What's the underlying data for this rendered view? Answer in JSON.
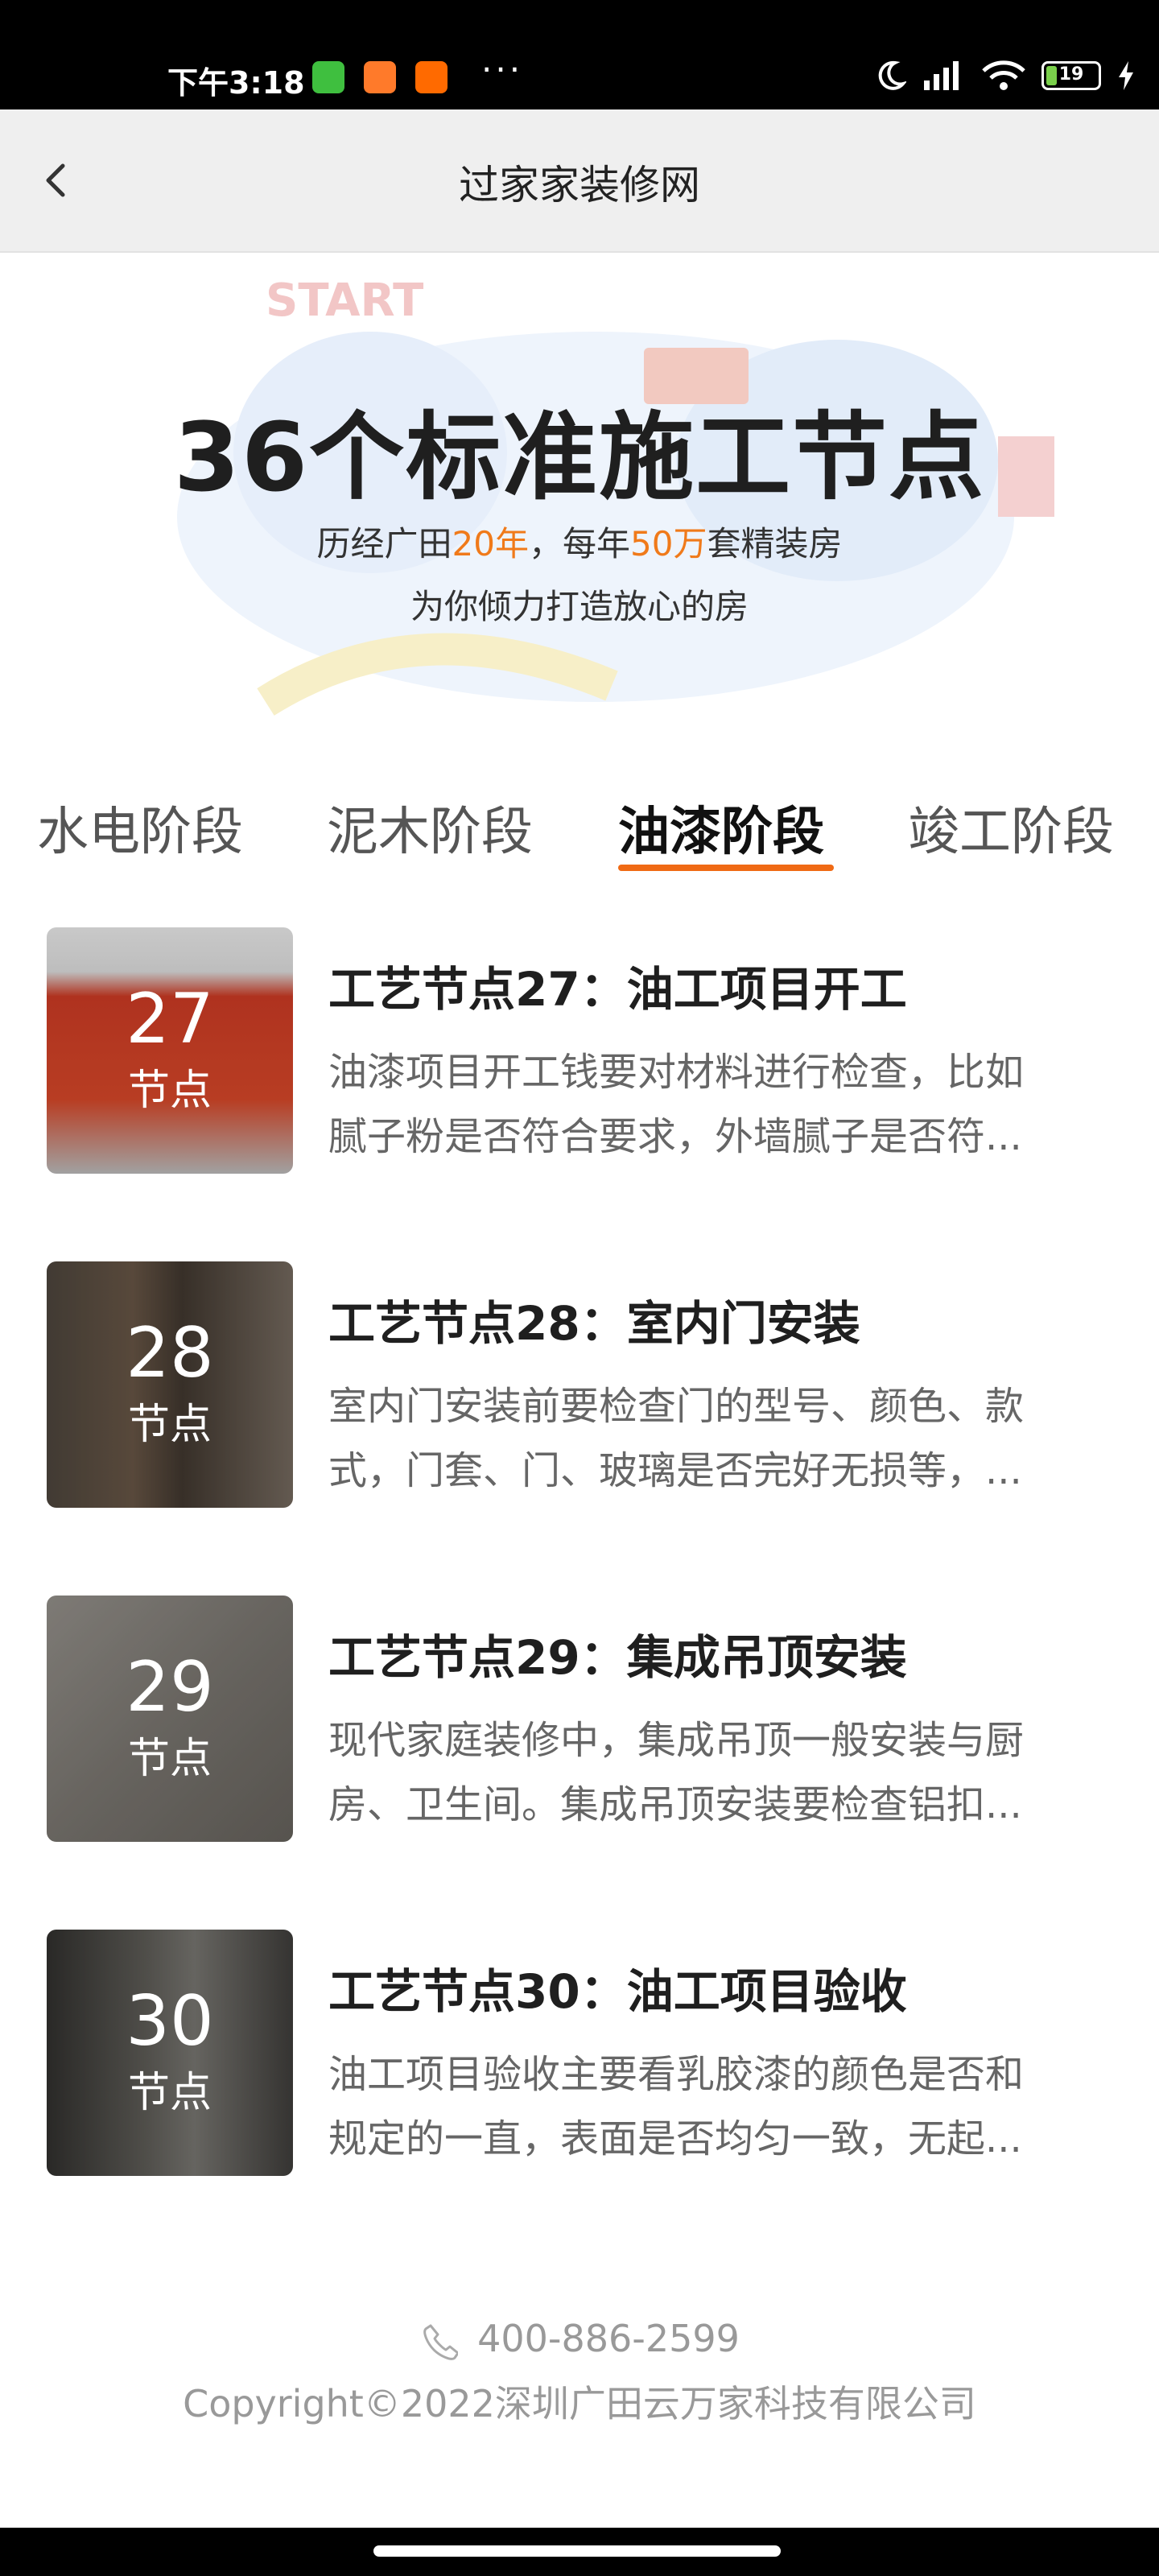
{
  "status_bar": {
    "time": "下午3:18",
    "dots": "···",
    "battery": "19",
    "colors": {
      "app1": "#3fbf3f",
      "app2": "#ff7a2a",
      "app3": "#ff6a00"
    }
  },
  "nav": {
    "title": "过家家装修网"
  },
  "banner": {
    "title": "36个标准施工节点",
    "sub1_prefix": "历经广田",
    "sub1_years": "20年",
    "sub1_mid": "，每年",
    "sub1_count": "50万",
    "sub1_suffix": "套精装房",
    "sub2": "为你倾力打造放心的房"
  },
  "tabs": [
    {
      "label": "水电阶段"
    },
    {
      "label": "泥木阶段"
    },
    {
      "label": "油漆阶段",
      "active": true
    },
    {
      "label": "竣工阶段"
    }
  ],
  "items": [
    {
      "num": "27",
      "label": "节点",
      "title": "工艺节点27：油工项目开工",
      "desc1": "油漆项目开工钱要对材料进行检查，比如",
      "desc2": "腻子粉是否符合要求，外墙腻子是否符..."
    },
    {
      "num": "28",
      "label": "节点",
      "title": "工艺节点28：室内门安装",
      "desc1": "室内门安装前要检查门的型号、颜色、款",
      "desc2": "式，门套、门、玻璃是否完好无损等，..."
    },
    {
      "num": "29",
      "label": "节点",
      "title": "工艺节点29：集成吊顶安装",
      "desc1": "现代家庭装修中，集成吊顶一般安装与厨",
      "desc2": "房、卫生间。集成吊顶安装要检查铝扣..."
    },
    {
      "num": "30",
      "label": "节点",
      "title": "工艺节点30：油工项目验收",
      "desc1": "油工项目验收主要看乳胶漆的颜色是否和",
      "desc2": "规定的一直，表面是否均匀一致，无起..."
    }
  ],
  "footer": {
    "phone": "400-886-2599",
    "copyright": "Copyright©2022深圳广田云万家科技有限公司"
  },
  "accent": "#f06a14"
}
